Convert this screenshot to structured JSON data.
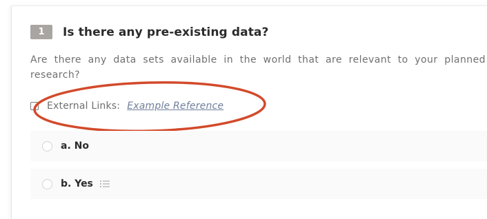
{
  "question": {
    "number": "1",
    "title": "Is there any pre-existing data?",
    "description": "Are there any data sets available in the world that are relevant to your planned research?"
  },
  "external_links": {
    "label": "External Links:",
    "value": "Example Reference"
  },
  "options": [
    {
      "label": "a. No"
    },
    {
      "label": "b. Yes",
      "icon": "list-icon"
    }
  ],
  "colors": {
    "annotation_ellipse": "#d24a2b",
    "number_badge": "#a9a6a1",
    "link_text": "#6f7f9b"
  }
}
